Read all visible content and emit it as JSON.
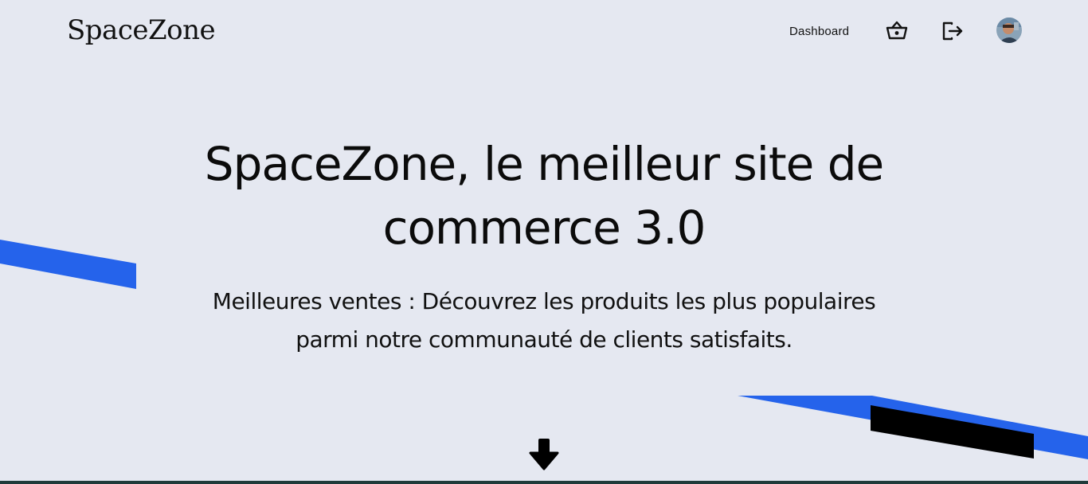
{
  "header": {
    "brand": "SpaceZone",
    "nav": {
      "dashboard_label": "Dashboard",
      "basket_icon": "basket-icon",
      "logout_icon": "logout-icon",
      "avatar": "user-avatar"
    }
  },
  "hero": {
    "title_line1": "SpaceZone, le meilleur site de",
    "title_line2": "commerce 3.0",
    "subtitle_line1": "Meilleures ventes : Découvrez les produits les plus populaires",
    "subtitle_line2": "parmi notre communauté de clients satisfaits.",
    "scroll_icon": "arrow-down-icon"
  },
  "colors": {
    "background": "#e5e8f1",
    "accent_blue": "#2563eb",
    "text": "#111111"
  }
}
